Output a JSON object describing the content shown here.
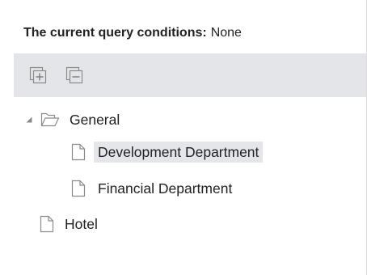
{
  "query": {
    "label": "The current query conditions:",
    "value": "None"
  },
  "toolbar": {
    "buttons": [
      {
        "name": "expand-all-button",
        "icon": "expand-all-icon"
      },
      {
        "name": "collapse-all-button",
        "icon": "collapse-all-icon"
      }
    ]
  },
  "tree": {
    "nodes": [
      {
        "label": "General",
        "icon": "folder-open-icon",
        "expanded": true,
        "level": 0
      },
      {
        "label": "Development Department",
        "icon": "document-icon",
        "level": 1,
        "selected": true
      },
      {
        "label": "Financial Department",
        "icon": "document-icon",
        "level": 1
      },
      {
        "label": "Hotel",
        "icon": "document-icon",
        "level": 0
      }
    ]
  },
  "colors": {
    "toolbar_background": "#e3e5e8",
    "selected_background": "#e4e6ea",
    "icon_stroke": "#8a8a8a",
    "text": "#222222"
  }
}
